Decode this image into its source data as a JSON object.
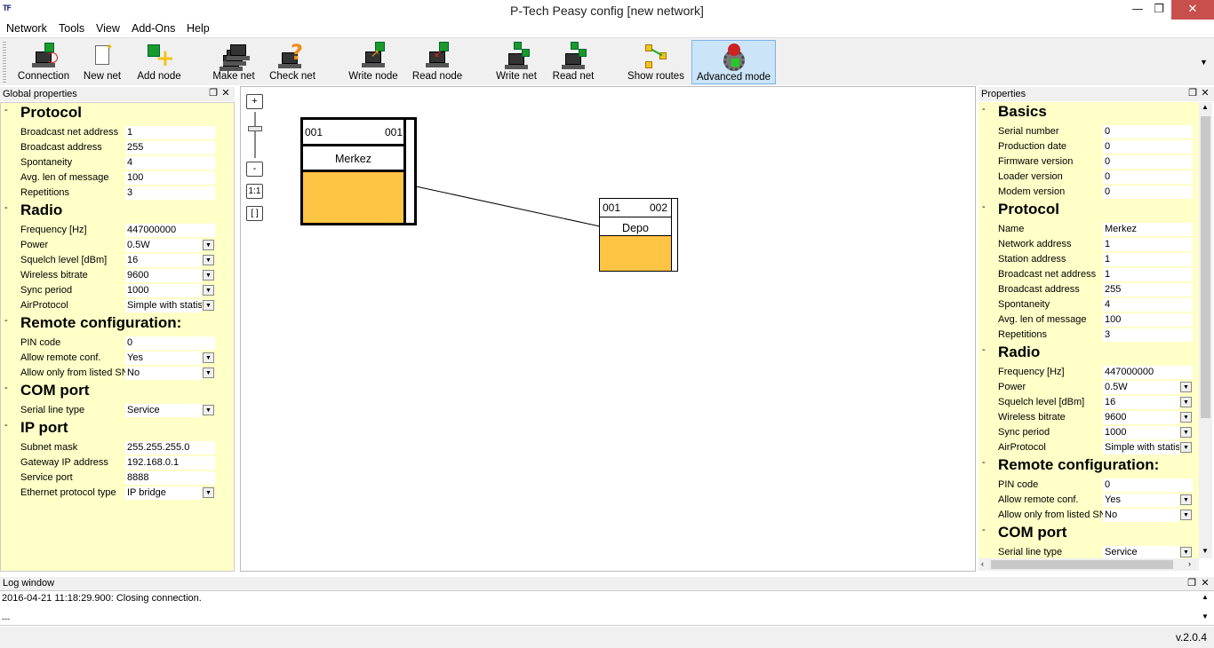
{
  "window": {
    "logo": "TF",
    "title": "P-Tech Peasy config [new network]",
    "minimize": "—",
    "restore": "❐",
    "close": "✕"
  },
  "menu": [
    "Network",
    "Tools",
    "View",
    "Add-Ons",
    "Help"
  ],
  "toolbar": [
    {
      "label": "Connection",
      "icon": "connection-icon"
    },
    {
      "label": "New net",
      "icon": "new-net-icon"
    },
    {
      "label": "Add node",
      "icon": "add-node-icon"
    },
    {
      "label": "Make net",
      "icon": "make-net-icon"
    },
    {
      "label": "Check net",
      "icon": "check-net-icon"
    },
    {
      "label": "Write node",
      "icon": "write-node-icon"
    },
    {
      "label": "Read node",
      "icon": "read-node-icon"
    },
    {
      "label": "Write net",
      "icon": "write-net-icon"
    },
    {
      "label": "Read net",
      "icon": "read-net-icon"
    },
    {
      "label": "Show routes",
      "icon": "show-routes-icon"
    },
    {
      "label": "Advanced mode",
      "icon": "advanced-mode-icon",
      "active": true
    }
  ],
  "global": {
    "title": "Global properties",
    "protocol": {
      "title": "Protocol",
      "rows": [
        {
          "label": "Broadcast net address",
          "value": "1"
        },
        {
          "label": "Broadcast address",
          "value": "255"
        },
        {
          "label": "Spontaneity",
          "value": "4"
        },
        {
          "label": "Avg. len of message",
          "value": "100"
        },
        {
          "label": "Repetitions",
          "value": "3"
        }
      ]
    },
    "radio": {
      "title": "Radio",
      "rows": [
        {
          "label": "Frequency [Hz]",
          "value": "447000000"
        },
        {
          "label": "Power",
          "value": "0.5W",
          "dropdown": true
        },
        {
          "label": "Squelch level [dBm]",
          "value": "16",
          "dropdown": true
        },
        {
          "label": "Wireless bitrate",
          "value": "9600",
          "dropdown": true
        },
        {
          "label": "Sync period",
          "value": "1000",
          "dropdown": true
        },
        {
          "label": "AirProtocol",
          "value": "Simple with statis",
          "dropdown": true
        }
      ]
    },
    "remote": {
      "title": "Remote configuration:",
      "rows": [
        {
          "label": "PIN code",
          "value": "0"
        },
        {
          "label": "Allow remote conf.",
          "value": "Yes",
          "dropdown": true
        },
        {
          "label": "Allow only from listed SN",
          "value": "No",
          "dropdown": true
        }
      ]
    },
    "com": {
      "title": "COM port",
      "rows": [
        {
          "label": "Serial line type",
          "value": "Service",
          "dropdown": true
        }
      ]
    },
    "ip": {
      "title": "IP port",
      "rows": [
        {
          "label": "Subnet mask",
          "value": "255.255.255.0"
        },
        {
          "label": "Gateway IP address",
          "value": "192.168.0.1"
        },
        {
          "label": "Service port",
          "value": "8888"
        },
        {
          "label": "Ethernet protocol type",
          "value": "IP bridge",
          "dropdown": true
        }
      ]
    }
  },
  "canvas": {
    "zoom_in": "+",
    "zoom_out": "-",
    "zoom_reset": "1:1",
    "zoom_fit": "[ ]",
    "nodes": [
      {
        "net": "001",
        "station": "001",
        "name": "Merkez"
      },
      {
        "net": "001",
        "station": "002",
        "name": "Depo"
      }
    ]
  },
  "props": {
    "title": "Properties",
    "basics": {
      "title": "Basics",
      "rows": [
        {
          "label": "Serial number",
          "value": "0"
        },
        {
          "label": "Production date",
          "value": "0"
        },
        {
          "label": "Firmware version",
          "value": "0"
        },
        {
          "label": "Loader version",
          "value": "0"
        },
        {
          "label": "Modem version",
          "value": "0"
        }
      ]
    },
    "protocol": {
      "title": "Protocol",
      "rows": [
        {
          "label": "Name",
          "value": "Merkez"
        },
        {
          "label": "Network address",
          "value": "1"
        },
        {
          "label": "Station address",
          "value": "1"
        },
        {
          "label": "Broadcast net address",
          "value": "1"
        },
        {
          "label": "Broadcast address",
          "value": "255"
        },
        {
          "label": "Spontaneity",
          "value": "4"
        },
        {
          "label": "Avg. len of message",
          "value": "100"
        },
        {
          "label": "Repetitions",
          "value": "3"
        }
      ]
    },
    "radio": {
      "title": "Radio",
      "rows": [
        {
          "label": "Frequency [Hz]",
          "value": "447000000"
        },
        {
          "label": "Power",
          "value": "0.5W",
          "dropdown": true
        },
        {
          "label": "Squelch level [dBm]",
          "value": "16",
          "dropdown": true
        },
        {
          "label": "Wireless bitrate",
          "value": "9600",
          "dropdown": true
        },
        {
          "label": "Sync period",
          "value": "1000",
          "dropdown": true
        },
        {
          "label": "AirProtocol",
          "value": "Simple with statis",
          "dropdown": true
        }
      ]
    },
    "remote": {
      "title": "Remote configuration:",
      "rows": [
        {
          "label": "PIN code",
          "value": "0"
        },
        {
          "label": "Allow remote conf.",
          "value": "Yes",
          "dropdown": true
        },
        {
          "label": "Allow only from listed SN",
          "value": "No",
          "dropdown": true
        }
      ]
    },
    "com": {
      "title": "COM port",
      "rows": [
        {
          "label": "Serial line type",
          "value": "Service",
          "dropdown": true
        }
      ]
    }
  },
  "log": {
    "title": "Log window",
    "lines": [
      "2016-04-21 11:18:29.900: Closing connection.",
      "---"
    ]
  },
  "status": {
    "version": "v.2.0.4"
  },
  "colors": {
    "panel_bg": "#ffffc8",
    "node_fill": "#fec444",
    "active_tool": "#cce4f7",
    "close_button": "#c7504c"
  }
}
